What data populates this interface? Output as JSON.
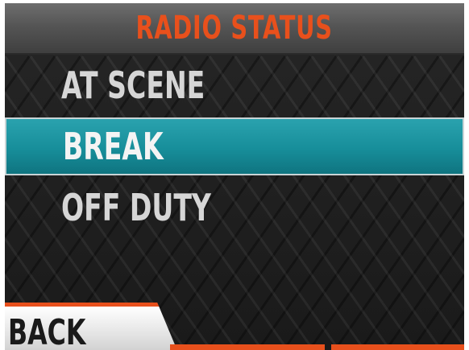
{
  "header": {
    "title": "RADIO STATUS"
  },
  "menu": {
    "items": [
      {
        "label": "AT SCENE",
        "selected": false
      },
      {
        "label": "BREAK",
        "selected": true
      },
      {
        "label": "OFF DUTY",
        "selected": false
      }
    ]
  },
  "softkeys": {
    "left_label": "BACK",
    "middle_label": "",
    "right_label": ""
  },
  "colors": {
    "accent": "#e8501c",
    "selection": "#178e9a",
    "text": "#d6d6d6",
    "background": "#1e1e1e"
  }
}
